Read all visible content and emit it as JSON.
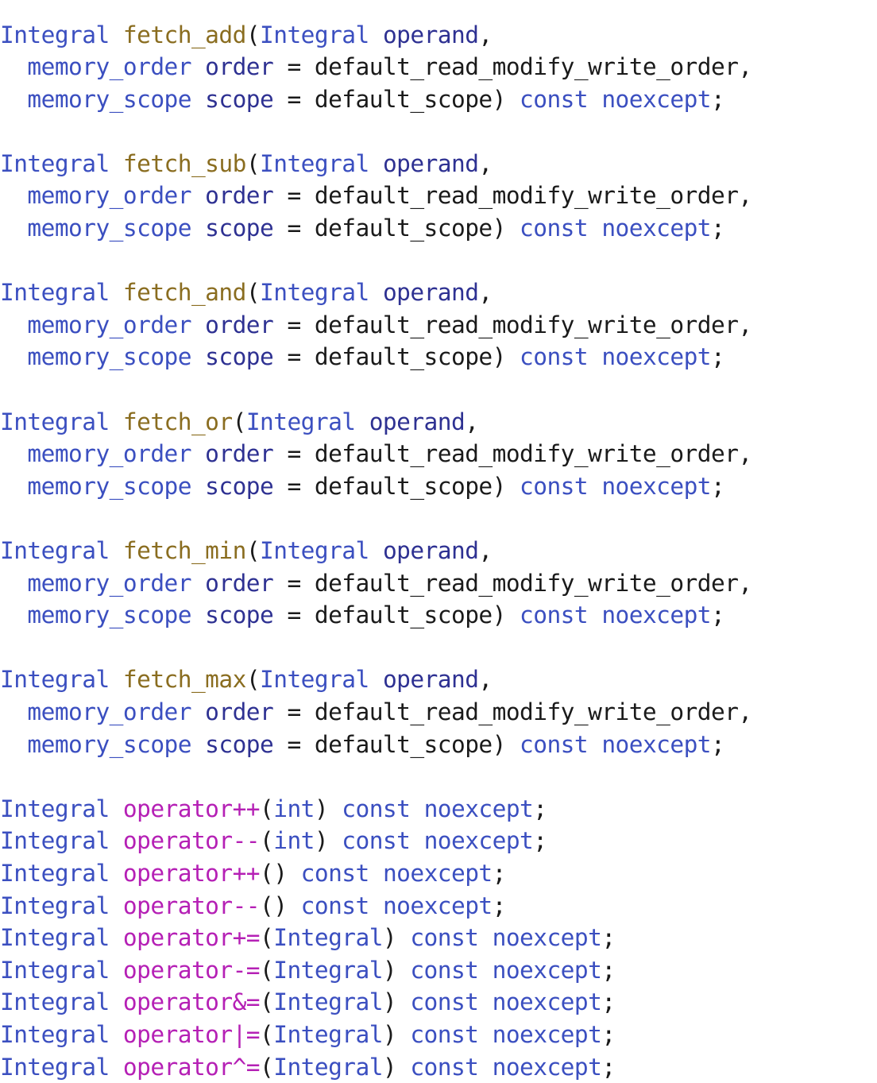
{
  "document": {
    "kind": "source-code-listing",
    "language": "C++",
    "font_size_px": 29.5,
    "line_height_px": 40.6,
    "background_color": "#ffffff"
  },
  "palette": {
    "type_color": "#3b4fc0",
    "keyword_color": "#3b4fc0",
    "function_name_color": "#8a6d20",
    "operator_name_color": "#b520b5",
    "variable_color": "#2e3192",
    "plain_text_color": "#1a1a1a"
  },
  "lines": [
    {
      "id": "line-1",
      "tokens": [
        {
          "t": "Integral",
          "c": "tok-type"
        },
        {
          "t": " ",
          "c": "tok-plain"
        },
        {
          "t": "fetch_add",
          "c": "tok-fn"
        },
        {
          "t": "(",
          "c": "tok-punc"
        },
        {
          "t": "Integral",
          "c": "tok-type"
        },
        {
          "t": " ",
          "c": "tok-plain"
        },
        {
          "t": "operand",
          "c": "tok-var"
        },
        {
          "t": ",",
          "c": "tok-punc"
        }
      ]
    },
    {
      "id": "line-2",
      "tokens": [
        {
          "t": "  ",
          "c": "tok-plain"
        },
        {
          "t": "memory_order",
          "c": "tok-type"
        },
        {
          "t": " ",
          "c": "tok-plain"
        },
        {
          "t": "order",
          "c": "tok-var"
        },
        {
          "t": " = ",
          "c": "tok-plain"
        },
        {
          "t": "default_read_modify_write_order",
          "c": "tok-plain"
        },
        {
          "t": ",",
          "c": "tok-punc"
        }
      ]
    },
    {
      "id": "line-3",
      "tokens": [
        {
          "t": "  ",
          "c": "tok-plain"
        },
        {
          "t": "memory_scope",
          "c": "tok-type"
        },
        {
          "t": " ",
          "c": "tok-plain"
        },
        {
          "t": "scope",
          "c": "tok-var"
        },
        {
          "t": " = ",
          "c": "tok-plain"
        },
        {
          "t": "default_scope",
          "c": "tok-plain"
        },
        {
          "t": ") ",
          "c": "tok-punc"
        },
        {
          "t": "const",
          "c": "tok-kw"
        },
        {
          "t": " ",
          "c": "tok-plain"
        },
        {
          "t": "noexcept",
          "c": "tok-kw"
        },
        {
          "t": ";",
          "c": "tok-punc"
        }
      ]
    },
    {
      "id": "line-4",
      "blank": true,
      "tokens": []
    },
    {
      "id": "line-5",
      "tokens": [
        {
          "t": "Integral",
          "c": "tok-type"
        },
        {
          "t": " ",
          "c": "tok-plain"
        },
        {
          "t": "fetch_sub",
          "c": "tok-fn"
        },
        {
          "t": "(",
          "c": "tok-punc"
        },
        {
          "t": "Integral",
          "c": "tok-type"
        },
        {
          "t": " ",
          "c": "tok-plain"
        },
        {
          "t": "operand",
          "c": "tok-var"
        },
        {
          "t": ",",
          "c": "tok-punc"
        }
      ]
    },
    {
      "id": "line-6",
      "tokens": [
        {
          "t": "  ",
          "c": "tok-plain"
        },
        {
          "t": "memory_order",
          "c": "tok-type"
        },
        {
          "t": " ",
          "c": "tok-plain"
        },
        {
          "t": "order",
          "c": "tok-var"
        },
        {
          "t": " = ",
          "c": "tok-plain"
        },
        {
          "t": "default_read_modify_write_order",
          "c": "tok-plain"
        },
        {
          "t": ",",
          "c": "tok-punc"
        }
      ]
    },
    {
      "id": "line-7",
      "tokens": [
        {
          "t": "  ",
          "c": "tok-plain"
        },
        {
          "t": "memory_scope",
          "c": "tok-type"
        },
        {
          "t": " ",
          "c": "tok-plain"
        },
        {
          "t": "scope",
          "c": "tok-var"
        },
        {
          "t": " = ",
          "c": "tok-plain"
        },
        {
          "t": "default_scope",
          "c": "tok-plain"
        },
        {
          "t": ") ",
          "c": "tok-punc"
        },
        {
          "t": "const",
          "c": "tok-kw"
        },
        {
          "t": " ",
          "c": "tok-plain"
        },
        {
          "t": "noexcept",
          "c": "tok-kw"
        },
        {
          "t": ";",
          "c": "tok-punc"
        }
      ]
    },
    {
      "id": "line-8",
      "blank": true,
      "tokens": []
    },
    {
      "id": "line-9",
      "tokens": [
        {
          "t": "Integral",
          "c": "tok-type"
        },
        {
          "t": " ",
          "c": "tok-plain"
        },
        {
          "t": "fetch_and",
          "c": "tok-fn"
        },
        {
          "t": "(",
          "c": "tok-punc"
        },
        {
          "t": "Integral",
          "c": "tok-type"
        },
        {
          "t": " ",
          "c": "tok-plain"
        },
        {
          "t": "operand",
          "c": "tok-var"
        },
        {
          "t": ",",
          "c": "tok-punc"
        }
      ]
    },
    {
      "id": "line-10",
      "tokens": [
        {
          "t": "  ",
          "c": "tok-plain"
        },
        {
          "t": "memory_order",
          "c": "tok-type"
        },
        {
          "t": " ",
          "c": "tok-plain"
        },
        {
          "t": "order",
          "c": "tok-var"
        },
        {
          "t": " = ",
          "c": "tok-plain"
        },
        {
          "t": "default_read_modify_write_order",
          "c": "tok-plain"
        },
        {
          "t": ",",
          "c": "tok-punc"
        }
      ]
    },
    {
      "id": "line-11",
      "tokens": [
        {
          "t": "  ",
          "c": "tok-plain"
        },
        {
          "t": "memory_scope",
          "c": "tok-type"
        },
        {
          "t": " ",
          "c": "tok-plain"
        },
        {
          "t": "scope",
          "c": "tok-var"
        },
        {
          "t": " = ",
          "c": "tok-plain"
        },
        {
          "t": "default_scope",
          "c": "tok-plain"
        },
        {
          "t": ") ",
          "c": "tok-punc"
        },
        {
          "t": "const",
          "c": "tok-kw"
        },
        {
          "t": " ",
          "c": "tok-plain"
        },
        {
          "t": "noexcept",
          "c": "tok-kw"
        },
        {
          "t": ";",
          "c": "tok-punc"
        }
      ]
    },
    {
      "id": "line-12",
      "blank": true,
      "tokens": []
    },
    {
      "id": "line-13",
      "tokens": [
        {
          "t": "Integral",
          "c": "tok-type"
        },
        {
          "t": " ",
          "c": "tok-plain"
        },
        {
          "t": "fetch_or",
          "c": "tok-fn"
        },
        {
          "t": "(",
          "c": "tok-punc"
        },
        {
          "t": "Integral",
          "c": "tok-type"
        },
        {
          "t": " ",
          "c": "tok-plain"
        },
        {
          "t": "operand",
          "c": "tok-var"
        },
        {
          "t": ",",
          "c": "tok-punc"
        }
      ]
    },
    {
      "id": "line-14",
      "tokens": [
        {
          "t": "  ",
          "c": "tok-plain"
        },
        {
          "t": "memory_order",
          "c": "tok-type"
        },
        {
          "t": " ",
          "c": "tok-plain"
        },
        {
          "t": "order",
          "c": "tok-var"
        },
        {
          "t": " = ",
          "c": "tok-plain"
        },
        {
          "t": "default_read_modify_write_order",
          "c": "tok-plain"
        },
        {
          "t": ",",
          "c": "tok-punc"
        }
      ]
    },
    {
      "id": "line-15",
      "tokens": [
        {
          "t": "  ",
          "c": "tok-plain"
        },
        {
          "t": "memory_scope",
          "c": "tok-type"
        },
        {
          "t": " ",
          "c": "tok-plain"
        },
        {
          "t": "scope",
          "c": "tok-var"
        },
        {
          "t": " = ",
          "c": "tok-plain"
        },
        {
          "t": "default_scope",
          "c": "tok-plain"
        },
        {
          "t": ") ",
          "c": "tok-punc"
        },
        {
          "t": "const",
          "c": "tok-kw"
        },
        {
          "t": " ",
          "c": "tok-plain"
        },
        {
          "t": "noexcept",
          "c": "tok-kw"
        },
        {
          "t": ";",
          "c": "tok-punc"
        }
      ]
    },
    {
      "id": "line-16",
      "blank": true,
      "tokens": []
    },
    {
      "id": "line-17",
      "tokens": [
        {
          "t": "Integral",
          "c": "tok-type"
        },
        {
          "t": " ",
          "c": "tok-plain"
        },
        {
          "t": "fetch_min",
          "c": "tok-fn"
        },
        {
          "t": "(",
          "c": "tok-punc"
        },
        {
          "t": "Integral",
          "c": "tok-type"
        },
        {
          "t": " ",
          "c": "tok-plain"
        },
        {
          "t": "operand",
          "c": "tok-var"
        },
        {
          "t": ",",
          "c": "tok-punc"
        }
      ]
    },
    {
      "id": "line-18",
      "tokens": [
        {
          "t": "  ",
          "c": "tok-plain"
        },
        {
          "t": "memory_order",
          "c": "tok-type"
        },
        {
          "t": " ",
          "c": "tok-plain"
        },
        {
          "t": "order",
          "c": "tok-var"
        },
        {
          "t": " = ",
          "c": "tok-plain"
        },
        {
          "t": "default_read_modify_write_order",
          "c": "tok-plain"
        },
        {
          "t": ",",
          "c": "tok-punc"
        }
      ]
    },
    {
      "id": "line-19",
      "tokens": [
        {
          "t": "  ",
          "c": "tok-plain"
        },
        {
          "t": "memory_scope",
          "c": "tok-type"
        },
        {
          "t": " ",
          "c": "tok-plain"
        },
        {
          "t": "scope",
          "c": "tok-var"
        },
        {
          "t": " = ",
          "c": "tok-plain"
        },
        {
          "t": "default_scope",
          "c": "tok-plain"
        },
        {
          "t": ") ",
          "c": "tok-punc"
        },
        {
          "t": "const",
          "c": "tok-kw"
        },
        {
          "t": " ",
          "c": "tok-plain"
        },
        {
          "t": "noexcept",
          "c": "tok-kw"
        },
        {
          "t": ";",
          "c": "tok-punc"
        }
      ]
    },
    {
      "id": "line-20",
      "blank": true,
      "tokens": []
    },
    {
      "id": "line-21",
      "tokens": [
        {
          "t": "Integral",
          "c": "tok-type"
        },
        {
          "t": " ",
          "c": "tok-plain"
        },
        {
          "t": "fetch_max",
          "c": "tok-fn"
        },
        {
          "t": "(",
          "c": "tok-punc"
        },
        {
          "t": "Integral",
          "c": "tok-type"
        },
        {
          "t": " ",
          "c": "tok-plain"
        },
        {
          "t": "operand",
          "c": "tok-var"
        },
        {
          "t": ",",
          "c": "tok-punc"
        }
      ]
    },
    {
      "id": "line-22",
      "tokens": [
        {
          "t": "  ",
          "c": "tok-plain"
        },
        {
          "t": "memory_order",
          "c": "tok-type"
        },
        {
          "t": " ",
          "c": "tok-plain"
        },
        {
          "t": "order",
          "c": "tok-var"
        },
        {
          "t": " = ",
          "c": "tok-plain"
        },
        {
          "t": "default_read_modify_write_order",
          "c": "tok-plain"
        },
        {
          "t": ",",
          "c": "tok-punc"
        }
      ]
    },
    {
      "id": "line-23",
      "tokens": [
        {
          "t": "  ",
          "c": "tok-plain"
        },
        {
          "t": "memory_scope",
          "c": "tok-type"
        },
        {
          "t": " ",
          "c": "tok-plain"
        },
        {
          "t": "scope",
          "c": "tok-var"
        },
        {
          "t": " = ",
          "c": "tok-plain"
        },
        {
          "t": "default_scope",
          "c": "tok-plain"
        },
        {
          "t": ") ",
          "c": "tok-punc"
        },
        {
          "t": "const",
          "c": "tok-kw"
        },
        {
          "t": " ",
          "c": "tok-plain"
        },
        {
          "t": "noexcept",
          "c": "tok-kw"
        },
        {
          "t": ";",
          "c": "tok-punc"
        }
      ]
    },
    {
      "id": "line-24",
      "blank": true,
      "tokens": []
    },
    {
      "id": "line-25",
      "tokens": [
        {
          "t": "Integral",
          "c": "tok-type"
        },
        {
          "t": " ",
          "c": "tok-plain"
        },
        {
          "t": "operator++",
          "c": "tok-op"
        },
        {
          "t": "(",
          "c": "tok-punc"
        },
        {
          "t": "int",
          "c": "tok-type"
        },
        {
          "t": ") ",
          "c": "tok-punc"
        },
        {
          "t": "const",
          "c": "tok-kw"
        },
        {
          "t": " ",
          "c": "tok-plain"
        },
        {
          "t": "noexcept",
          "c": "tok-kw"
        },
        {
          "t": ";",
          "c": "tok-punc"
        }
      ]
    },
    {
      "id": "line-26",
      "tokens": [
        {
          "t": "Integral",
          "c": "tok-type"
        },
        {
          "t": " ",
          "c": "tok-plain"
        },
        {
          "t": "operator--",
          "c": "tok-op"
        },
        {
          "t": "(",
          "c": "tok-punc"
        },
        {
          "t": "int",
          "c": "tok-type"
        },
        {
          "t": ") ",
          "c": "tok-punc"
        },
        {
          "t": "const",
          "c": "tok-kw"
        },
        {
          "t": " ",
          "c": "tok-plain"
        },
        {
          "t": "noexcept",
          "c": "tok-kw"
        },
        {
          "t": ";",
          "c": "tok-punc"
        }
      ]
    },
    {
      "id": "line-27",
      "tokens": [
        {
          "t": "Integral",
          "c": "tok-type"
        },
        {
          "t": " ",
          "c": "tok-plain"
        },
        {
          "t": "operator++",
          "c": "tok-op"
        },
        {
          "t": "() ",
          "c": "tok-punc"
        },
        {
          "t": "const",
          "c": "tok-kw"
        },
        {
          "t": " ",
          "c": "tok-plain"
        },
        {
          "t": "noexcept",
          "c": "tok-kw"
        },
        {
          "t": ";",
          "c": "tok-punc"
        }
      ]
    },
    {
      "id": "line-28",
      "tokens": [
        {
          "t": "Integral",
          "c": "tok-type"
        },
        {
          "t": " ",
          "c": "tok-plain"
        },
        {
          "t": "operator--",
          "c": "tok-op"
        },
        {
          "t": "() ",
          "c": "tok-punc"
        },
        {
          "t": "const",
          "c": "tok-kw"
        },
        {
          "t": " ",
          "c": "tok-plain"
        },
        {
          "t": "noexcept",
          "c": "tok-kw"
        },
        {
          "t": ";",
          "c": "tok-punc"
        }
      ]
    },
    {
      "id": "line-29",
      "tokens": [
        {
          "t": "Integral",
          "c": "tok-type"
        },
        {
          "t": " ",
          "c": "tok-plain"
        },
        {
          "t": "operator+=",
          "c": "tok-op"
        },
        {
          "t": "(",
          "c": "tok-punc"
        },
        {
          "t": "Integral",
          "c": "tok-type"
        },
        {
          "t": ") ",
          "c": "tok-punc"
        },
        {
          "t": "const",
          "c": "tok-kw"
        },
        {
          "t": " ",
          "c": "tok-plain"
        },
        {
          "t": "noexcept",
          "c": "tok-kw"
        },
        {
          "t": ";",
          "c": "tok-punc"
        }
      ]
    },
    {
      "id": "line-30",
      "tokens": [
        {
          "t": "Integral",
          "c": "tok-type"
        },
        {
          "t": " ",
          "c": "tok-plain"
        },
        {
          "t": "operator-=",
          "c": "tok-op"
        },
        {
          "t": "(",
          "c": "tok-punc"
        },
        {
          "t": "Integral",
          "c": "tok-type"
        },
        {
          "t": ") ",
          "c": "tok-punc"
        },
        {
          "t": "const",
          "c": "tok-kw"
        },
        {
          "t": " ",
          "c": "tok-plain"
        },
        {
          "t": "noexcept",
          "c": "tok-kw"
        },
        {
          "t": ";",
          "c": "tok-punc"
        }
      ]
    },
    {
      "id": "line-31",
      "tokens": [
        {
          "t": "Integral",
          "c": "tok-type"
        },
        {
          "t": " ",
          "c": "tok-plain"
        },
        {
          "t": "operator&=",
          "c": "tok-op"
        },
        {
          "t": "(",
          "c": "tok-punc"
        },
        {
          "t": "Integral",
          "c": "tok-type"
        },
        {
          "t": ") ",
          "c": "tok-punc"
        },
        {
          "t": "const",
          "c": "tok-kw"
        },
        {
          "t": " ",
          "c": "tok-plain"
        },
        {
          "t": "noexcept",
          "c": "tok-kw"
        },
        {
          "t": ";",
          "c": "tok-punc"
        }
      ]
    },
    {
      "id": "line-32",
      "tokens": [
        {
          "t": "Integral",
          "c": "tok-type"
        },
        {
          "t": " ",
          "c": "tok-plain"
        },
        {
          "t": "operator|=",
          "c": "tok-op"
        },
        {
          "t": "(",
          "c": "tok-punc"
        },
        {
          "t": "Integral",
          "c": "tok-type"
        },
        {
          "t": ") ",
          "c": "tok-punc"
        },
        {
          "t": "const",
          "c": "tok-kw"
        },
        {
          "t": " ",
          "c": "tok-plain"
        },
        {
          "t": "noexcept",
          "c": "tok-kw"
        },
        {
          "t": ";",
          "c": "tok-punc"
        }
      ]
    },
    {
      "id": "line-33",
      "tokens": [
        {
          "t": "Integral",
          "c": "tok-type"
        },
        {
          "t": " ",
          "c": "tok-plain"
        },
        {
          "t": "operator^=",
          "c": "tok-op"
        },
        {
          "t": "(",
          "c": "tok-punc"
        },
        {
          "t": "Integral",
          "c": "tok-type"
        },
        {
          "t": ") ",
          "c": "tok-punc"
        },
        {
          "t": "const",
          "c": "tok-kw"
        },
        {
          "t": " ",
          "c": "tok-plain"
        },
        {
          "t": "noexcept",
          "c": "tok-kw"
        },
        {
          "t": ";",
          "c": "tok-punc"
        }
      ]
    }
  ]
}
